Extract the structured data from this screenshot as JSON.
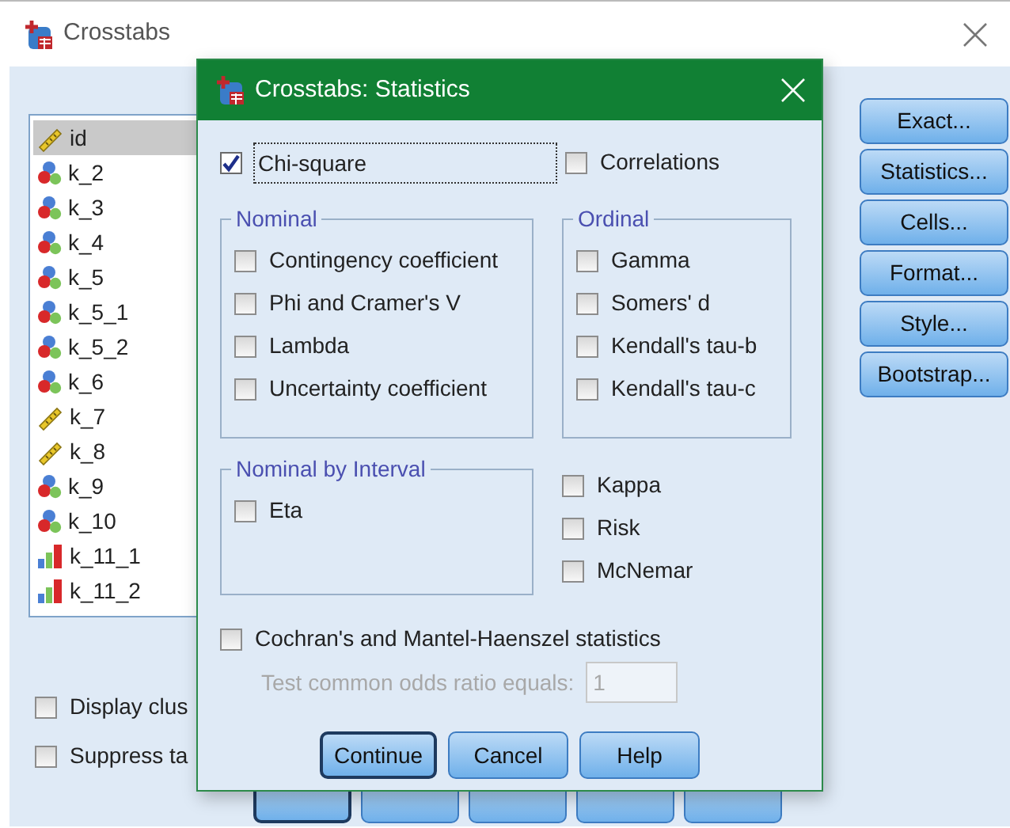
{
  "window": {
    "title": "Crosstabs"
  },
  "variables": [
    {
      "name": "id",
      "kind": "scale",
      "selected": true
    },
    {
      "name": "k_2",
      "kind": "nominal",
      "selected": false
    },
    {
      "name": "k_3",
      "kind": "nominal",
      "selected": false
    },
    {
      "name": "k_4",
      "kind": "nominal",
      "selected": false
    },
    {
      "name": "k_5",
      "kind": "nominal",
      "selected": false
    },
    {
      "name": "k_5_1",
      "kind": "nominal",
      "selected": false
    },
    {
      "name": "k_5_2",
      "kind": "nominal",
      "selected": false
    },
    {
      "name": "k_6",
      "kind": "nominal",
      "selected": false
    },
    {
      "name": "k_7",
      "kind": "scale",
      "selected": false
    },
    {
      "name": "k_8",
      "kind": "scale",
      "selected": false
    },
    {
      "name": "k_9",
      "kind": "nominal",
      "selected": false
    },
    {
      "name": "k_10",
      "kind": "nominal",
      "selected": false
    },
    {
      "name": "k_11_1",
      "kind": "ordinal",
      "selected": false
    },
    {
      "name": "k_11_2",
      "kind": "ordinal",
      "selected": false
    }
  ],
  "side_buttons": [
    "Exact...",
    "Statistics...",
    "Cells...",
    "Format...",
    "Style...",
    "Bootstrap..."
  ],
  "options": [
    {
      "label": "Display clus",
      "checked": false
    },
    {
      "label": "Suppress ta",
      "checked": false
    }
  ],
  "bottom_buttons": [
    {
      "kind": "default"
    },
    {
      "kind": "plain"
    },
    {
      "kind": "plain"
    },
    {
      "kind": "plain"
    },
    {
      "kind": "plain"
    }
  ],
  "statistics": {
    "title": "Crosstabs: Statistics",
    "chi_square": {
      "label": "Chi-square",
      "checked": true,
      "focused": true
    },
    "correlations": {
      "label": "Correlations",
      "checked": false
    },
    "nominal": {
      "title": "Nominal",
      "items": [
        {
          "label": "Contingency coefficient",
          "checked": false
        },
        {
          "label": "Phi and Cramer's V",
          "checked": false
        },
        {
          "label": "Lambda",
          "checked": false
        },
        {
          "label": "Uncertainty coefficient",
          "checked": false
        }
      ]
    },
    "ordinal": {
      "title": "Ordinal",
      "items": [
        {
          "label": "Gamma",
          "checked": false
        },
        {
          "label": "Somers' d",
          "checked": false
        },
        {
          "label": "Kendall's tau-b",
          "checked": false
        },
        {
          "label": "Kendall's tau-c",
          "checked": false
        }
      ]
    },
    "nominal_by_interval": {
      "title": "Nominal by Interval",
      "items": [
        {
          "label": "Eta",
          "checked": false
        }
      ]
    },
    "other": [
      {
        "label": "Kappa",
        "checked": false
      },
      {
        "label": "Risk",
        "checked": false
      },
      {
        "label": "McNemar",
        "checked": false
      }
    ],
    "cochran": {
      "label": "Cochran's and Mantel-Haenszel statistics",
      "checked": false
    },
    "odds_ratio": {
      "label": "Test common odds ratio equals:",
      "value": "1",
      "disabled": true
    },
    "buttons": [
      {
        "label": "Continue",
        "default": true
      },
      {
        "label": "Cancel",
        "default": false
      },
      {
        "label": "Help",
        "default": false
      }
    ]
  }
}
